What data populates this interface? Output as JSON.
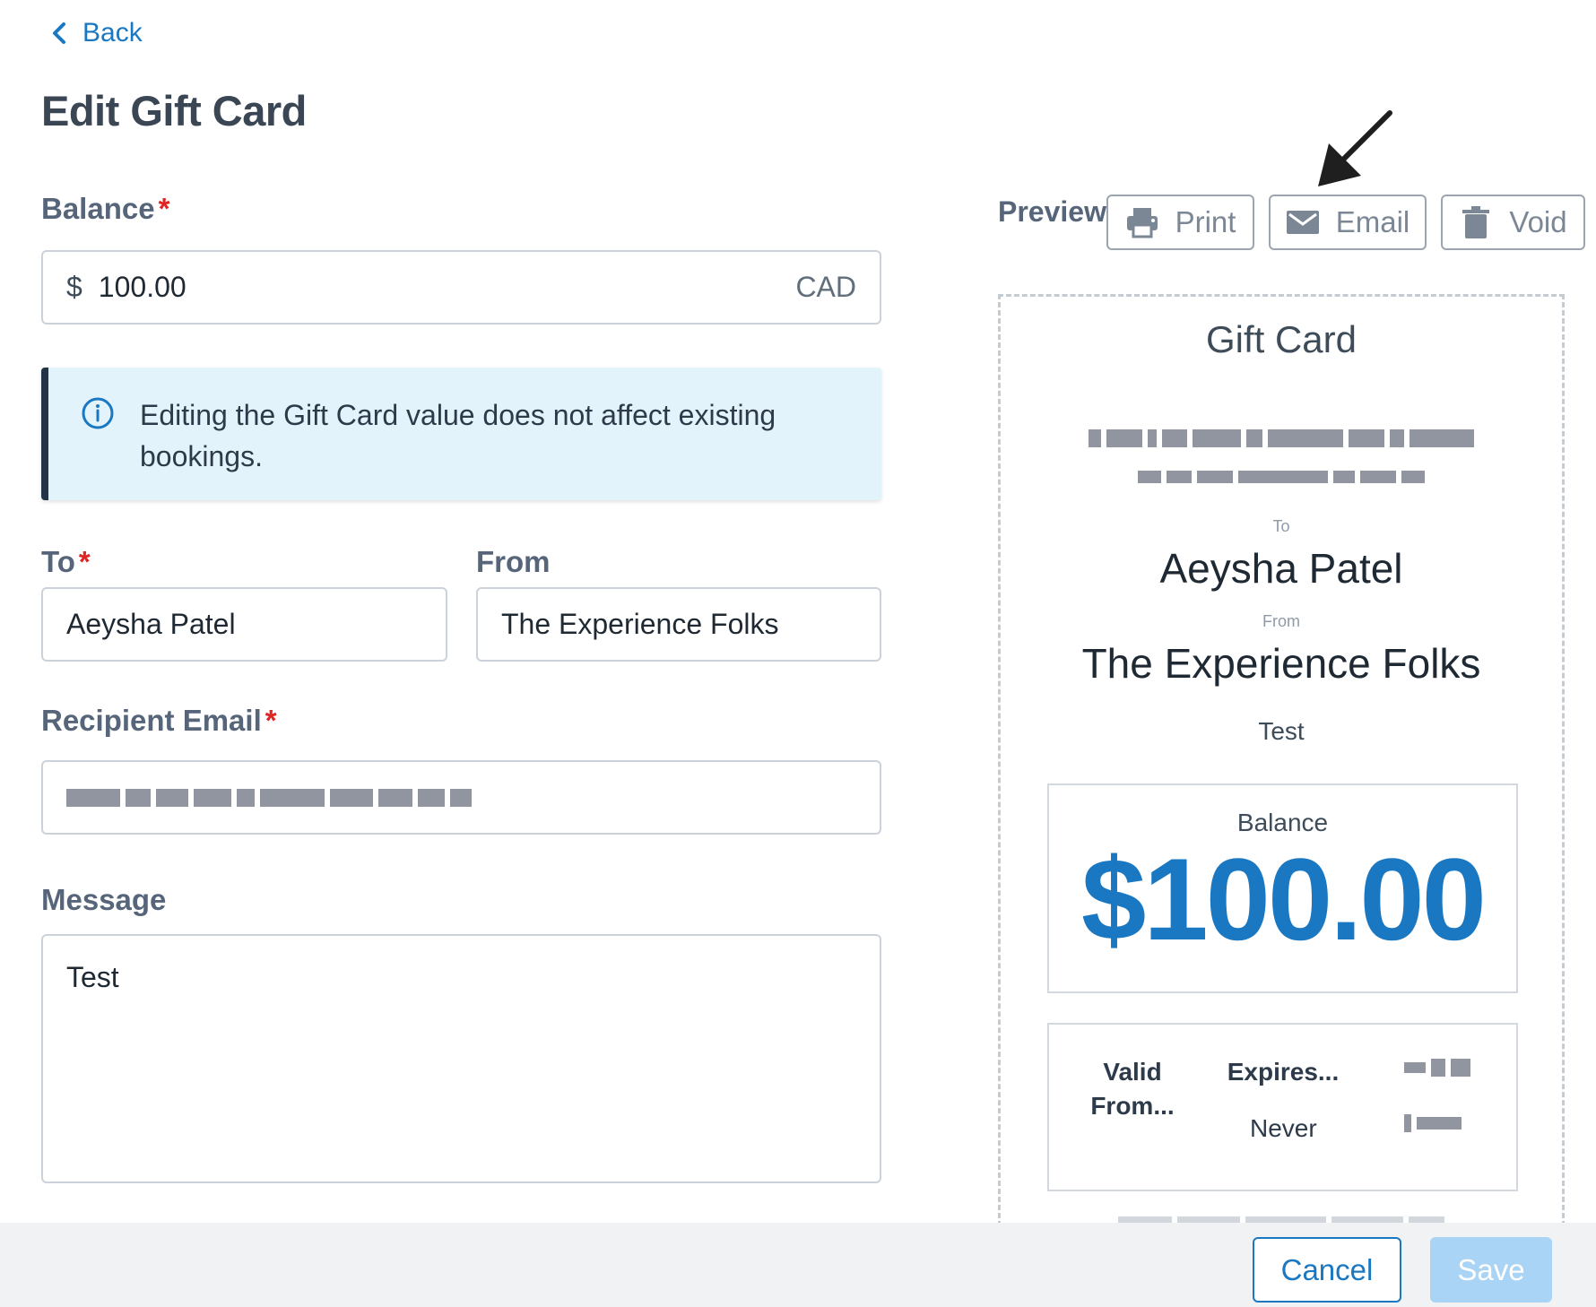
{
  "nav": {
    "back_label": "Back"
  },
  "page": {
    "title": "Edit Gift Card"
  },
  "form": {
    "balance": {
      "label": "Balance",
      "required_mark": "*",
      "currency_symbol": "$",
      "value": "100.00",
      "currency_code": "CAD"
    },
    "info": {
      "text": "Editing the Gift Card value does not affect existing bookings."
    },
    "to": {
      "label": "To",
      "required_mark": "*",
      "value": "Aeysha Patel"
    },
    "from": {
      "label": "From",
      "value": "The Experience Folks"
    },
    "recipient_email": {
      "label": "Recipient Email",
      "required_mark": "*"
    },
    "message": {
      "label": "Message",
      "value": "Test"
    }
  },
  "preview": {
    "label": "Preview",
    "actions": {
      "print": "Print",
      "email": "Email",
      "void": "Void"
    },
    "card": {
      "title": "Gift Card",
      "to_label": "To",
      "to_name": "Aeysha Patel",
      "from_label": "From",
      "from_name": "The Experience Folks",
      "message": "Test",
      "balance_label": "Balance",
      "balance_amount": "$100.00",
      "valid_from_label": "Valid From...",
      "expires_label": "Expires...",
      "expires_value": "Never"
    }
  },
  "footer": {
    "cancel_label": "Cancel",
    "save_label": "Save"
  },
  "colors": {
    "accent": "#1a78c2",
    "required": "#e02424",
    "info_bg": "#e3f3fc",
    "save_disabled": "#a9d4f5"
  }
}
